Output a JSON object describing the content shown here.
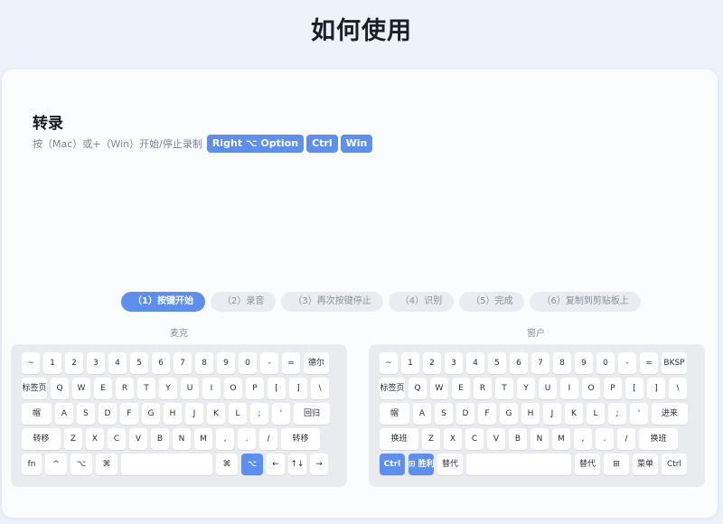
{
  "page": {
    "title": "如何使用"
  },
  "section": {
    "title": "转录",
    "instruction": "按（Mac）或+（Win）开始/停止录制",
    "shortcut_chips": [
      "Right ⌥ Option",
      "Ctrl",
      "Win"
    ]
  },
  "steps": [
    {
      "label": "（1）按键开始",
      "active": true
    },
    {
      "label": "（2）录音",
      "active": false
    },
    {
      "label": "（3）再次按键停止",
      "active": false
    },
    {
      "label": "（4）识别",
      "active": false
    },
    {
      "label": "（5）完成",
      "active": false
    },
    {
      "label": "（6）复制到剪贴板上",
      "active": false
    }
  ],
  "keyboards": {
    "mac": {
      "label": "麦克",
      "rows": [
        [
          "~",
          "1",
          "2",
          "3",
          "4",
          "5",
          "6",
          "7",
          "8",
          "9",
          "0",
          "-",
          "=",
          "德尔"
        ],
        [
          "标签页",
          "Q",
          "W",
          "E",
          "R",
          "T",
          "Y",
          "U",
          "I",
          "O",
          "P",
          "[",
          "]",
          "\\"
        ],
        [
          "帽",
          "A",
          "S",
          "D",
          "F",
          "G",
          "H",
          "J",
          "K",
          "L",
          ";",
          "'",
          "回归"
        ],
        [
          "转移",
          "Z",
          "X",
          "C",
          "V",
          "B",
          "N",
          "M",
          ",",
          ".",
          "/",
          "转移"
        ],
        [
          "fn",
          "^",
          "⌥",
          "⌘",
          "",
          "⌘",
          "⌥",
          "←",
          "↑↓",
          "→"
        ]
      ],
      "active": [
        "4-6"
      ]
    },
    "win": {
      "label": "窗户",
      "rows": [
        [
          "~",
          "1",
          "2",
          "3",
          "4",
          "5",
          "6",
          "7",
          "8",
          "9",
          "0",
          "-",
          "=",
          "BKSP"
        ],
        [
          "标签页",
          "Q",
          "W",
          "E",
          "R",
          "T",
          "Y",
          "U",
          "I",
          "O",
          "P",
          "[",
          "]",
          "\\"
        ],
        [
          "帽",
          "A",
          "S",
          "D",
          "F",
          "G",
          "H",
          "J",
          "K",
          "L",
          ";",
          "'",
          "进来"
        ],
        [
          "换班",
          "Z",
          "X",
          "C",
          "V",
          "B",
          "N",
          "M",
          ",",
          ".",
          "/",
          "换班"
        ],
        [
          "Ctrl",
          "⊞ 胜利",
          "替代",
          "",
          "替代",
          "⊞",
          "菜单",
          "Ctrl"
        ]
      ],
      "active": [
        "4-0",
        "4-1"
      ]
    }
  }
}
